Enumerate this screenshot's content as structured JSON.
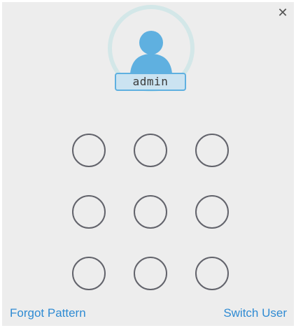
{
  "dialog": {
    "close_icon": "close-icon",
    "close_glyph": "✕"
  },
  "user": {
    "name": "admin",
    "avatar_icon": "user-avatar-icon"
  },
  "pattern": {
    "rows": 3,
    "cols": 3
  },
  "footer": {
    "forgot_label": "Forgot Pattern",
    "switch_label": "Switch User"
  },
  "colors": {
    "accent": "#2f8bd3",
    "avatar_blue": "#5fb0e0",
    "ring": "#d3e7e8",
    "badge_bg": "#cbe3f1",
    "dot_stroke": "#62636b",
    "background": "#ededed"
  }
}
